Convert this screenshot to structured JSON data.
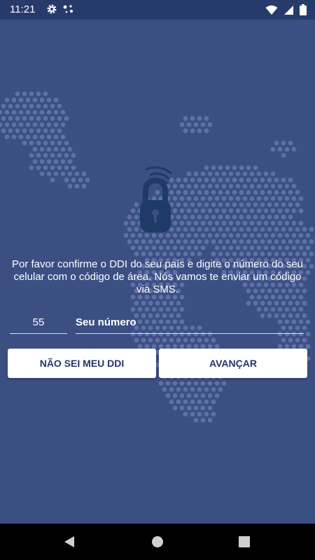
{
  "status": {
    "time": "11:21"
  },
  "message": "Por favor confirme o DDI do seu país e digite o número do seu celular com o código de área. Nós vamos te enviar um código via SMS.",
  "ddi": {
    "value": "55"
  },
  "phone": {
    "placeholder": "Seu número"
  },
  "buttons": {
    "unknown_ddi": "NÃO SEI MEU DDI",
    "next": "AVANÇAR"
  },
  "colors": {
    "background": "#3b4f83",
    "statusbar": "#273b6b",
    "button_text": "#24356d",
    "lock": "#1f3a66"
  }
}
